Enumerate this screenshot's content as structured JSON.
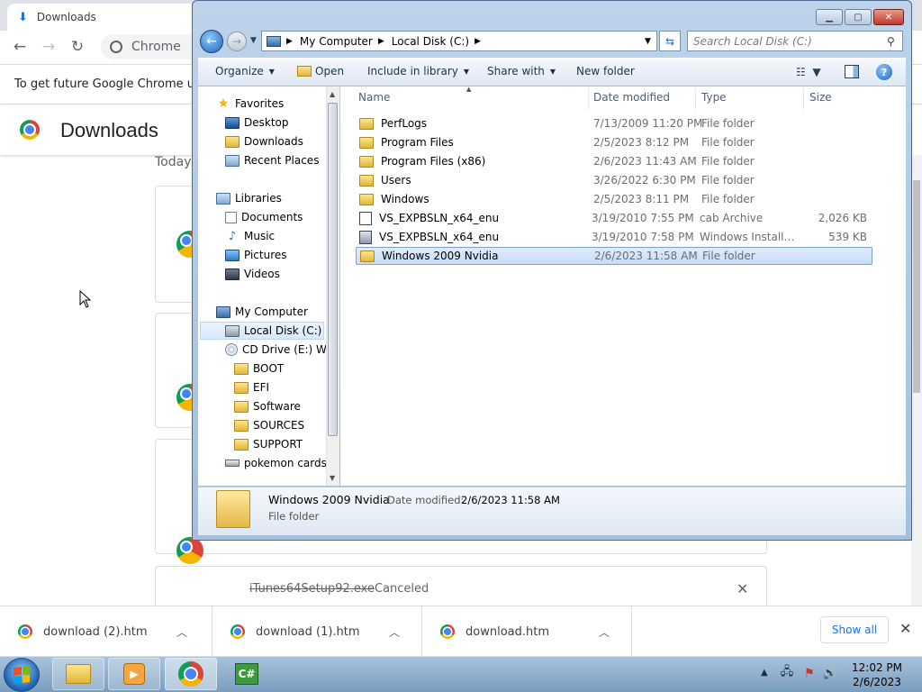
{
  "chrome": {
    "tab_title": "Downloads",
    "omnibox_text": "Chrome",
    "infobar_text": "To get future Google Chrome upda",
    "page_title": "Downloads",
    "section_today": "Today",
    "canceled_file": "iTunes64Setup92.exe",
    "canceled_status": "Canceled",
    "shelf": [
      {
        "name": "download (2).htm"
      },
      {
        "name": "download (1).htm"
      },
      {
        "name": "download.htm"
      }
    ],
    "show_all": "Show all"
  },
  "explorer": {
    "address": [
      "My Computer",
      "Local Disk (C:)"
    ],
    "search_placeholder": "Search Local Disk (C:)",
    "toolbar": {
      "organize": "Organize",
      "open": "Open",
      "include": "Include in library",
      "share": "Share with",
      "new_folder": "New folder"
    },
    "nav": {
      "favorites": "Favorites",
      "desktop": "Desktop",
      "downloads": "Downloads",
      "recent": "Recent Places",
      "libraries": "Libraries",
      "documents": "Documents",
      "music": "Music",
      "pictures": "Pictures",
      "videos": "Videos",
      "computer": "My Computer",
      "local_disk": "Local Disk (C:)",
      "cd_drive": "CD Drive (E:) WIN",
      "boot": "BOOT",
      "efi": "EFI",
      "software": "Software",
      "sources": "SOURCES",
      "support": "SUPPORT",
      "usb": "pokemon cards ("
    },
    "columns": {
      "name": "Name",
      "date": "Date modified",
      "type": "Type",
      "size": "Size"
    },
    "files": [
      {
        "name": "PerfLogs",
        "date": "7/13/2009 11:20 PM",
        "type": "File folder",
        "size": "",
        "icon": "folder-icon"
      },
      {
        "name": "Program Files",
        "date": "2/5/2023 8:12 PM",
        "type": "File folder",
        "size": "",
        "icon": "folder-icon"
      },
      {
        "name": "Program Files (x86)",
        "date": "2/6/2023 11:43 AM",
        "type": "File folder",
        "size": "",
        "icon": "folder-icon"
      },
      {
        "name": "Users",
        "date": "3/26/2022 6:30 PM",
        "type": "File folder",
        "size": "",
        "icon": "folder-icon"
      },
      {
        "name": "Windows",
        "date": "2/5/2023 8:11 PM",
        "type": "File folder",
        "size": "",
        "icon": "folder-icon"
      },
      {
        "name": "VS_EXPBSLN_x64_enu",
        "date": "3/19/2010 7:55 PM",
        "type": "cab Archive",
        "size": "2,026 KB",
        "icon": "cab-file-icon"
      },
      {
        "name": "VS_EXPBSLN_x64_enu",
        "date": "3/19/2010 7:58 PM",
        "type": "Windows Installer ...",
        "size": "539 KB",
        "icon": "installer-file-icon"
      },
      {
        "name": "Windows 2009 Nvidia",
        "date": "2/6/2023 11:58 AM",
        "type": "File folder",
        "size": "",
        "icon": "folder-icon"
      }
    ],
    "details": {
      "name": "Windows 2009 Nvidia",
      "date_label": "Date modified:",
      "date": "2/6/2023 11:58 AM",
      "type": "File folder"
    }
  },
  "taskbar": {
    "time": "12:02 PM",
    "date": "2/6/2023",
    "cs_label": "C#"
  }
}
